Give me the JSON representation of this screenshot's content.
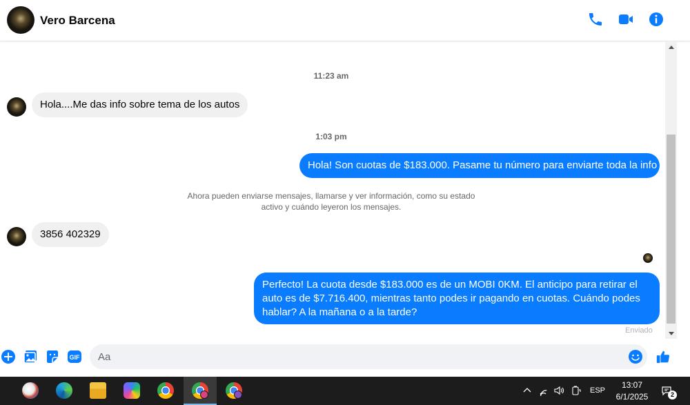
{
  "header": {
    "contact_name": "Vero Barcena",
    "icons": [
      "phone-icon",
      "video-camera-icon",
      "info-icon"
    ],
    "accent_color": "#0a7cff"
  },
  "conversation": {
    "timestamp_1": "11:23 am",
    "msg_in_1": "Hola....Me das info sobre tema de los autos",
    "timestamp_2": "1:03 pm",
    "msg_out_1": "Hola! Son cuotas de $183.000. Pasame tu número para enviarte toda la info",
    "info_notice": "Ahora pueden enviarse mensajes, llamarse y ver información, como su estado activo y cuándo leyeron los mensajes.",
    "msg_in_2": "3856 402329",
    "msg_out_2": "Perfecto! La cuota desde $183.000 es de un MOBI 0KM. El anticipo para retirar el auto es de $7.716.400, mientras tanto podes ir pagando en cuotas. Cuándo podes hablar? A la mañana o a la tarde?",
    "sent_status": "Enviado"
  },
  "composer": {
    "placeholder": "Aa",
    "icons": [
      "plus-icon",
      "image-icon",
      "sticker-icon",
      "gif-icon",
      "emoji-icon",
      "thumbs-up-icon"
    ],
    "gif_label": "GIF"
  },
  "taskbar": {
    "apps": [
      "paint-app",
      "edge-browser",
      "file-explorer",
      "copilot-app",
      "chrome-browser",
      "chrome-profile-c",
      "chrome-profile-2"
    ],
    "language": "ESP",
    "time": "13:07",
    "date": "6/1/2025",
    "notification_count": "2"
  }
}
